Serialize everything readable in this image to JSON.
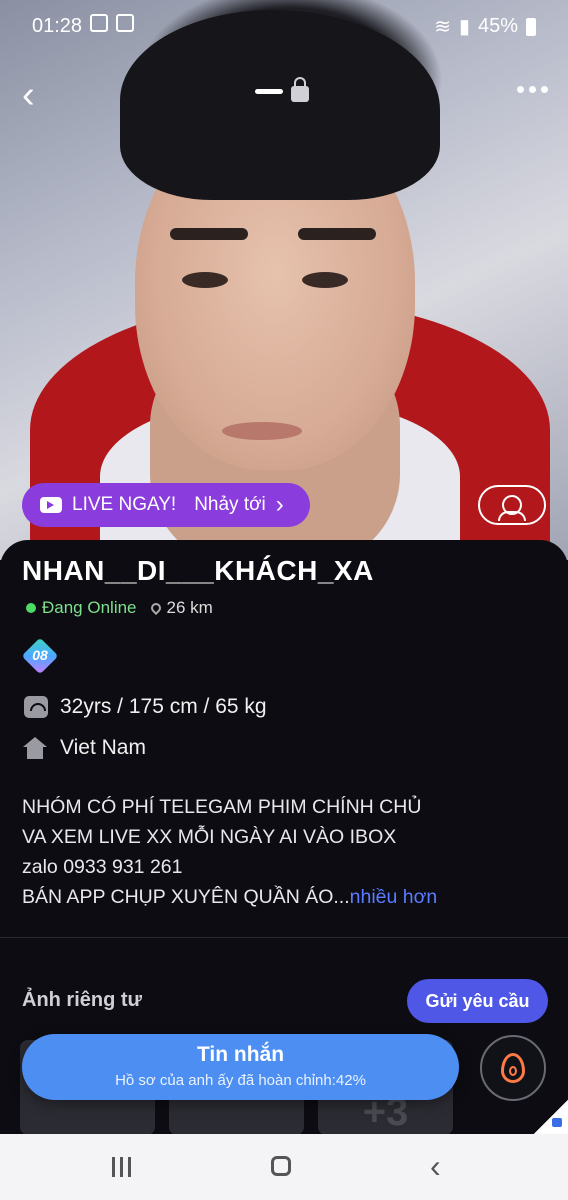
{
  "status_bar": {
    "time": "01:28",
    "battery": "45%"
  },
  "top_nav": {
    "back_icon": "chevron-left",
    "more_icon": "more-dots"
  },
  "live_banner": {
    "label": "LIVE NGAY!",
    "action": "Nhảy tới"
  },
  "profile": {
    "name": "NHAN__DI___KHÁCH_XA",
    "status": "Đang Online",
    "distance": "26 km",
    "badge": "08",
    "stats": "32yrs / 175 cm / 65 kg",
    "location": "Viet Nam",
    "bio_lines": [
      "NHÓM  CÓ PHÍ TELEGAM PHIM CHÍNH CHỦ",
      "VA XEM LIVE XX MỖI NGÀY AI VÀO IBOX",
      "zalo 0933 931 261",
      "BÁN APP CHỤP  XUYÊN QUẦN ÁO..."
    ],
    "bio_more": "nhiều hơn"
  },
  "private_photos": {
    "title": "Ảnh riêng tư",
    "request_button": "Gửi yêu cầu",
    "extra_count": "+3"
  },
  "message_button": {
    "title": "Tin nhắn",
    "subtitle": "Hồ sơ của anh ấy đã hoàn chỉnh:42%"
  },
  "colors": {
    "live_purple": "#8a3cdd",
    "request_blue": "#4f57e6",
    "message_blue": "#4c8ef2",
    "online_green": "#4cd964",
    "link_blue": "#5a7cff"
  }
}
